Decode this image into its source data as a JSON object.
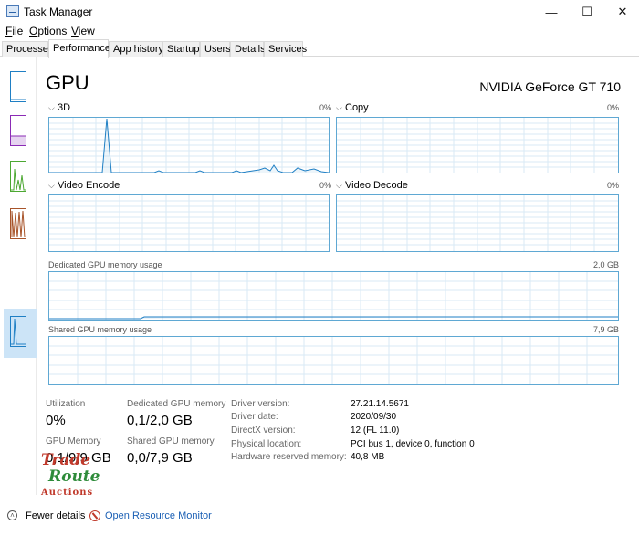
{
  "window": {
    "title": "Task Manager",
    "minimize_glyph": "—",
    "maximize_glyph": "☐",
    "close_glyph": "✕"
  },
  "menu": [
    {
      "label_ul": "F",
      "label_rest": "ile"
    },
    {
      "label_ul": "O",
      "label_rest": "ptions"
    },
    {
      "label_ul": "V",
      "label_rest": "iew"
    }
  ],
  "tabs": [
    "Processes",
    "Performance",
    "App history",
    "Startup",
    "Users",
    "Details",
    "Services"
  ],
  "active_tab": "Performance",
  "gpu": {
    "title": "GPU",
    "model": "NVIDIA GeForce GT 710"
  },
  "engines": [
    {
      "name": "3D",
      "percent": "0%"
    },
    {
      "name": "Copy",
      "percent": "0%"
    },
    {
      "name": "Video Encode",
      "percent": "0%"
    },
    {
      "name": "Video Decode",
      "percent": "0%"
    }
  ],
  "memory_graphs": {
    "dedicated": {
      "label": "Dedicated GPU memory usage",
      "max": "2,0 GB"
    },
    "shared": {
      "label": "Shared GPU memory usage",
      "max": "7,9 GB"
    }
  },
  "stats": {
    "utilization_label": "Utilization",
    "utilization_value": "0%",
    "dedicated_label": "Dedicated GPU memory",
    "dedicated_value": "0,1/2,0 GB",
    "gpu_memory_label": "GPU Memory",
    "gpu_memory_value": "0,1/9,9 GB",
    "shared_label": "Shared GPU memory",
    "shared_value": "0,0/7,9 GB"
  },
  "info": [
    {
      "label": "Driver version:",
      "value": "27.21.14.5671"
    },
    {
      "label": "Driver date:",
      "value": "2020/09/30"
    },
    {
      "label": "DirectX version:",
      "value": "12 (FL 11.0)"
    },
    {
      "label": "Physical location:",
      "value": "PCI bus 1, device 0, function 0"
    },
    {
      "label": "Hardware reserved memory:",
      "value": "40,8 MB"
    }
  ],
  "watermark": {
    "line1": "Trade",
    "line2": "Route",
    "line3": "Auctions"
  },
  "footer": {
    "fewer_ul": "d",
    "fewer_pre": "Fewer ",
    "fewer_post": "etails",
    "resource_monitor": "Open Resource Monitor"
  },
  "colors": {
    "graph_border": "#5fa8d3",
    "graph_grid": "#d9eaf6",
    "graph_line": "#1f7fc4",
    "selection": "#cce4f7"
  },
  "icons": {
    "app": "task-manager-icon",
    "fewer": "chevron-up-icon",
    "resource": "resource-monitor-icon"
  }
}
